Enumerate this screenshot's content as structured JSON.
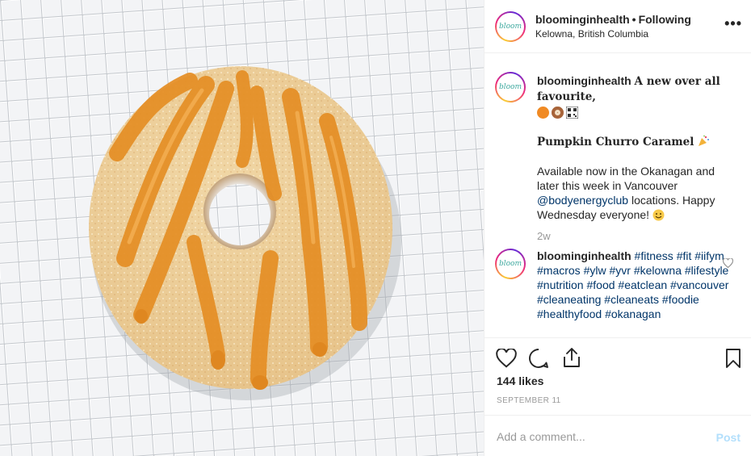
{
  "post": {
    "username": "bloominginhealth",
    "separator": "•",
    "follow_status": "Following",
    "location": "Kelowna, British Columbia",
    "more_label": "•••",
    "avatar_text": "bloom",
    "photo_icon": "caramel-donut-photo"
  },
  "caption": {
    "username": "bloominginhealth",
    "headline": "A new over all favourite,",
    "emoji_icons": [
      "pumpkin-icon",
      "donut-icon",
      "qr-code-icon"
    ],
    "flavor": "Pumpkin Churro Caramel",
    "flavor_icon": "party-popper-icon",
    "body_pre": "Available now in the Okanagan and later this week in Vancouver ",
    "mention": "@bodyenergyclub",
    "body_post": " locations. Happy Wednesday everyone! ",
    "body_icon": "smiley-icon",
    "age": "2w"
  },
  "comment": {
    "username": "bloominginhealth",
    "hashtags": [
      "#fitness",
      "#fit",
      "#iifym",
      "#macros",
      "#ylw",
      "#yvr",
      "#kelowna",
      "#lifestyle",
      "#nutrition",
      "#food",
      "#eatclean",
      "#vancouver",
      "#cleaneating",
      "#cleaneats",
      "#foodie",
      "#healthyfood",
      "#okanagan"
    ]
  },
  "stats": {
    "likes": "144 likes",
    "date": "SEPTEMBER 11"
  },
  "add_comment": {
    "placeholder": "Add a comment...",
    "post_label": "Post"
  },
  "colors": {
    "link": "#003569",
    "muted": "#999999",
    "post_disabled": "#b2dffc",
    "caramel": "#e7922a"
  }
}
